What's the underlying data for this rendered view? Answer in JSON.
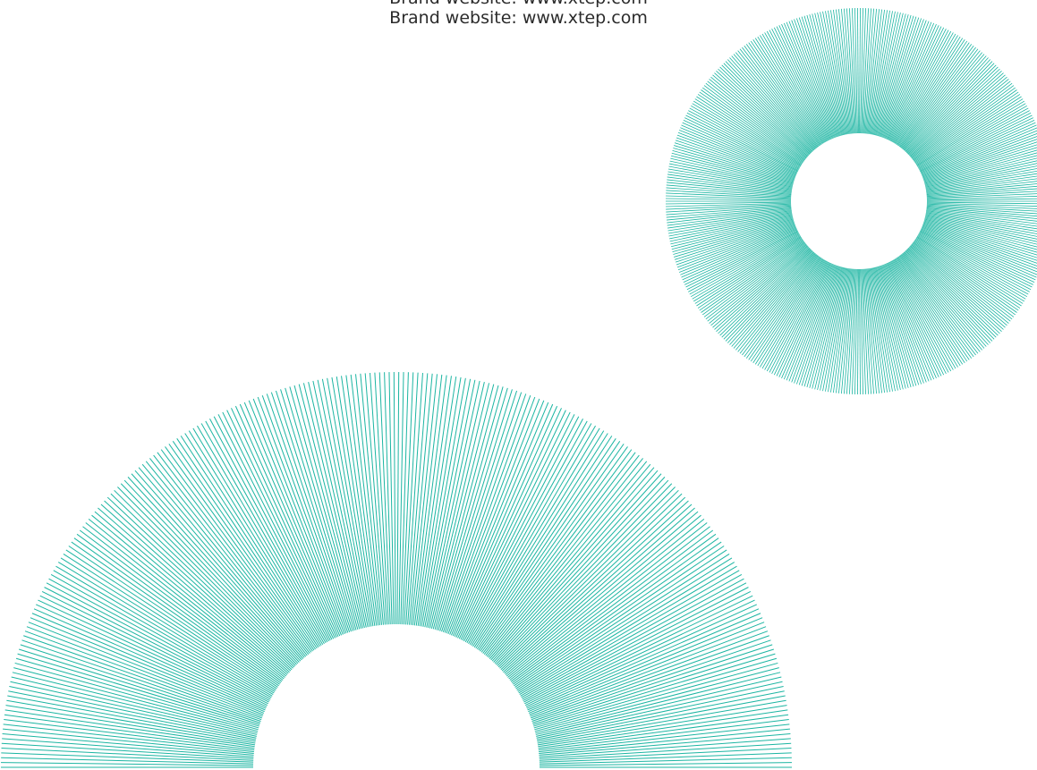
{
  "header": {
    "cut_text": "Brand website: www.xtep.com",
    "website_text": "Brand website: www.xtep.com"
  },
  "decor": {
    "accent_color": "#1cb5a2",
    "small_ring": {
      "shape": "full-ring",
      "style": "radial-lines"
    },
    "large_fan": {
      "shape": "half-ring",
      "style": "radial-lines"
    }
  }
}
